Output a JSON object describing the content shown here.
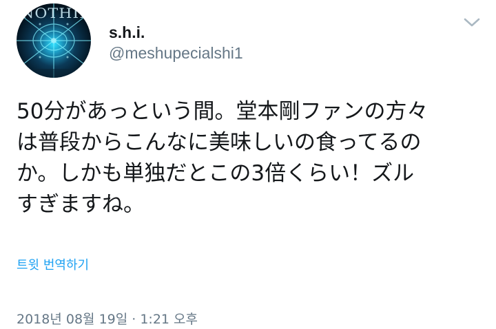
{
  "user": {
    "display_name": "s.h.i.",
    "handle": "@meshupecialshi1",
    "avatar_text": "NOTHING"
  },
  "tweet": {
    "text": "50分があっという間。堂本剛ファンの方々\nは普段からこんなに美味しいの食ってるの\nか。しかも単独だとこの3倍くらい！ズル\nすぎますね。",
    "translate_label": "트윗 번역하기",
    "timestamp": "2018년 08월 19일 · 1:21 오후"
  },
  "icons": {
    "menu": "chevron-down-icon"
  },
  "colors": {
    "link": "#1da1f2",
    "secondary": "#657786",
    "primary_text": "#14171a",
    "caret": "#aab8c2"
  }
}
